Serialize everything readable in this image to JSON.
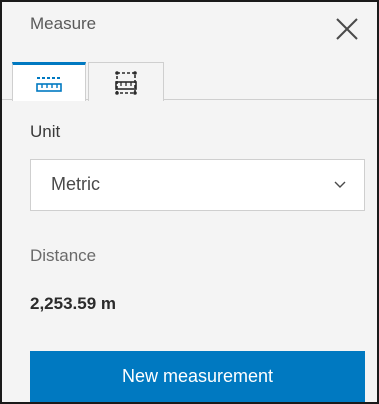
{
  "header": {
    "title": "Measure",
    "close_icon": "close-icon"
  },
  "tabs": [
    {
      "icon": "ruler-distance-icon",
      "active": true
    },
    {
      "icon": "area-measure-icon",
      "active": false
    }
  ],
  "unit": {
    "label": "Unit",
    "selected": "Metric",
    "dropdown_icon": "chevron-down-icon"
  },
  "result": {
    "label": "Distance",
    "value": "2,253.59 m"
  },
  "actions": {
    "new_measurement_label": "New measurement"
  },
  "colors": {
    "accent": "#0079c1",
    "panel_bg": "#f4f4f4"
  }
}
